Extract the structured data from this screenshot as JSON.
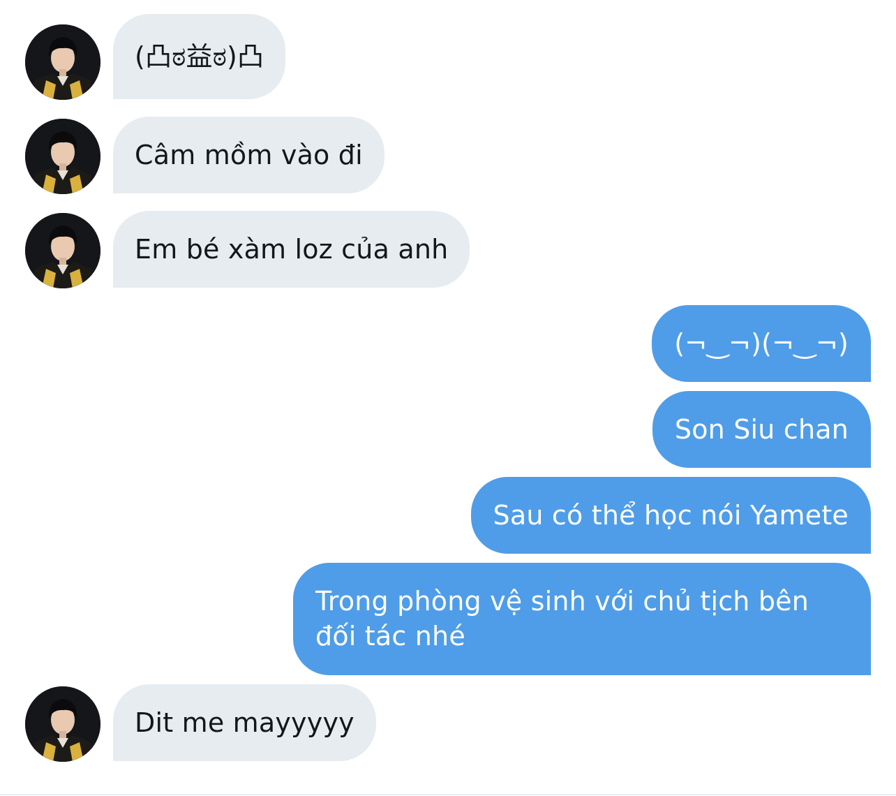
{
  "conversation": {
    "messages": [
      {
        "sender": "other",
        "text": "(凸ಠ益ಠ)凸"
      },
      {
        "sender": "other",
        "text": "Câm mồm vào đi"
      },
      {
        "sender": "other",
        "text": "Em bé xàm loz của anh"
      },
      {
        "sender": "me",
        "text": "(¬‿¬)(¬‿¬)"
      },
      {
        "sender": "me",
        "text": "Son Siu chan"
      },
      {
        "sender": "me",
        "text": "Sau có thể học nói Yamete"
      },
      {
        "sender": "me",
        "text": "Trong phòng vệ sinh với chủ tịch bên đối tác nhé"
      },
      {
        "sender": "other",
        "text": "Dit me mayyyyy"
      }
    ]
  },
  "colors": {
    "incoming_bubble": "#e6ecf0",
    "outgoing_bubble": "#4f9de8",
    "incoming_text": "#14171a",
    "outgoing_text": "#ffffff"
  }
}
